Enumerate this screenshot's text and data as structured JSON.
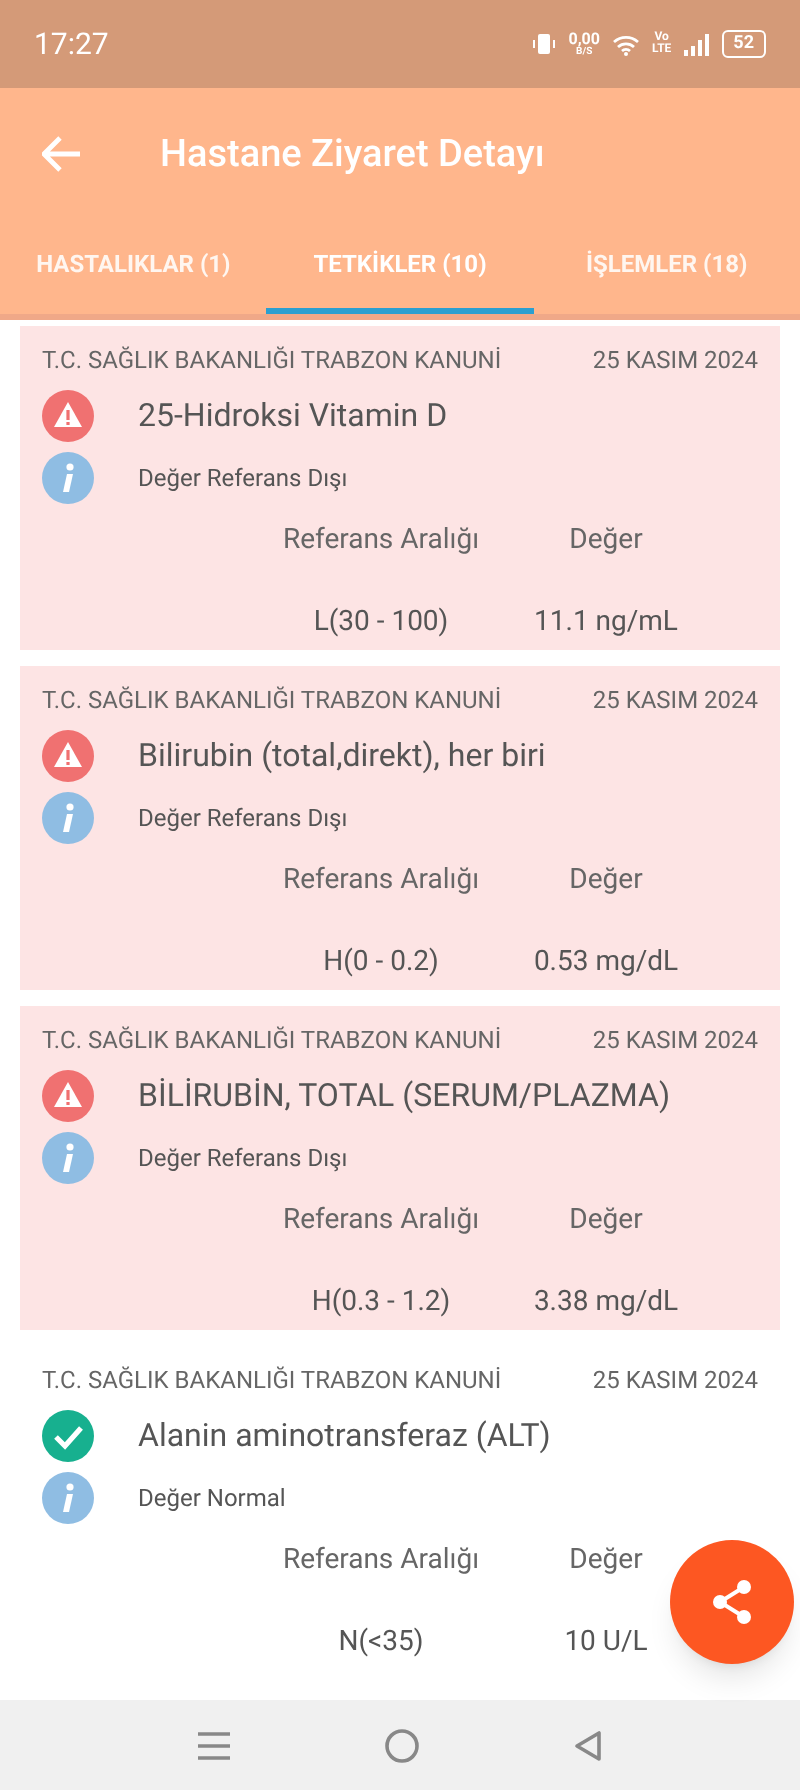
{
  "status_bar": {
    "time": "17:27",
    "net_speed": "0,00",
    "net_unit": "B/S",
    "volte": "Vo",
    "lte": "LTE",
    "battery": "52"
  },
  "app_bar": {
    "title": "Hastane Ziyaret Detayı"
  },
  "tabs": [
    {
      "label": "HASTALIKLAR (1)",
      "selected": false
    },
    {
      "label": "TETKİKLER (10)",
      "selected": true
    },
    {
      "label": "İŞLEMLER (18)",
      "selected": false
    }
  ],
  "tests": [
    {
      "institution": "T.C. SAĞLIK BAKANLIĞI TRABZON KANUNİ",
      "date": "25 KASIM 2024",
      "name": "25-Hidroksi Vitamin D",
      "kind": "abnormal",
      "note": "Değer Referans Dışı",
      "range_header": "Referans Aralığı",
      "value_header": "Değer",
      "range": "L(30 - 100)",
      "value": "11.1 ng/mL"
    },
    {
      "institution": "T.C. SAĞLIK BAKANLIĞI TRABZON KANUNİ",
      "date": "25 KASIM 2024",
      "name": "Bilirubin (total,direkt), her biri",
      "kind": "abnormal",
      "note": "Değer Referans Dışı",
      "range_header": "Referans Aralığı",
      "value_header": "Değer",
      "range": "H(0 - 0.2)",
      "value": "0.53 mg/dL"
    },
    {
      "institution": "T.C. SAĞLIK BAKANLIĞI TRABZON KANUNİ",
      "date": "25 KASIM 2024",
      "name": "BİLİRUBİN, TOTAL (SERUM/PLAZMA)",
      "kind": "abnormal",
      "note": "Değer Referans Dışı",
      "range_header": "Referans Aralığı",
      "value_header": "Değer",
      "range": "H(0.3 - 1.2)",
      "value": "3.38 mg/dL"
    },
    {
      "institution": "T.C. SAĞLIK BAKANLIĞI TRABZON KANUNİ",
      "date": "25 KASIM 2024",
      "name": "Alanin aminotransferaz (ALT)",
      "kind": "normal",
      "note": "Değer Normal",
      "range_header": "Referans Aralığı",
      "value_header": "Değer",
      "range": "N(<35)",
      "value": "10 U/L"
    }
  ]
}
